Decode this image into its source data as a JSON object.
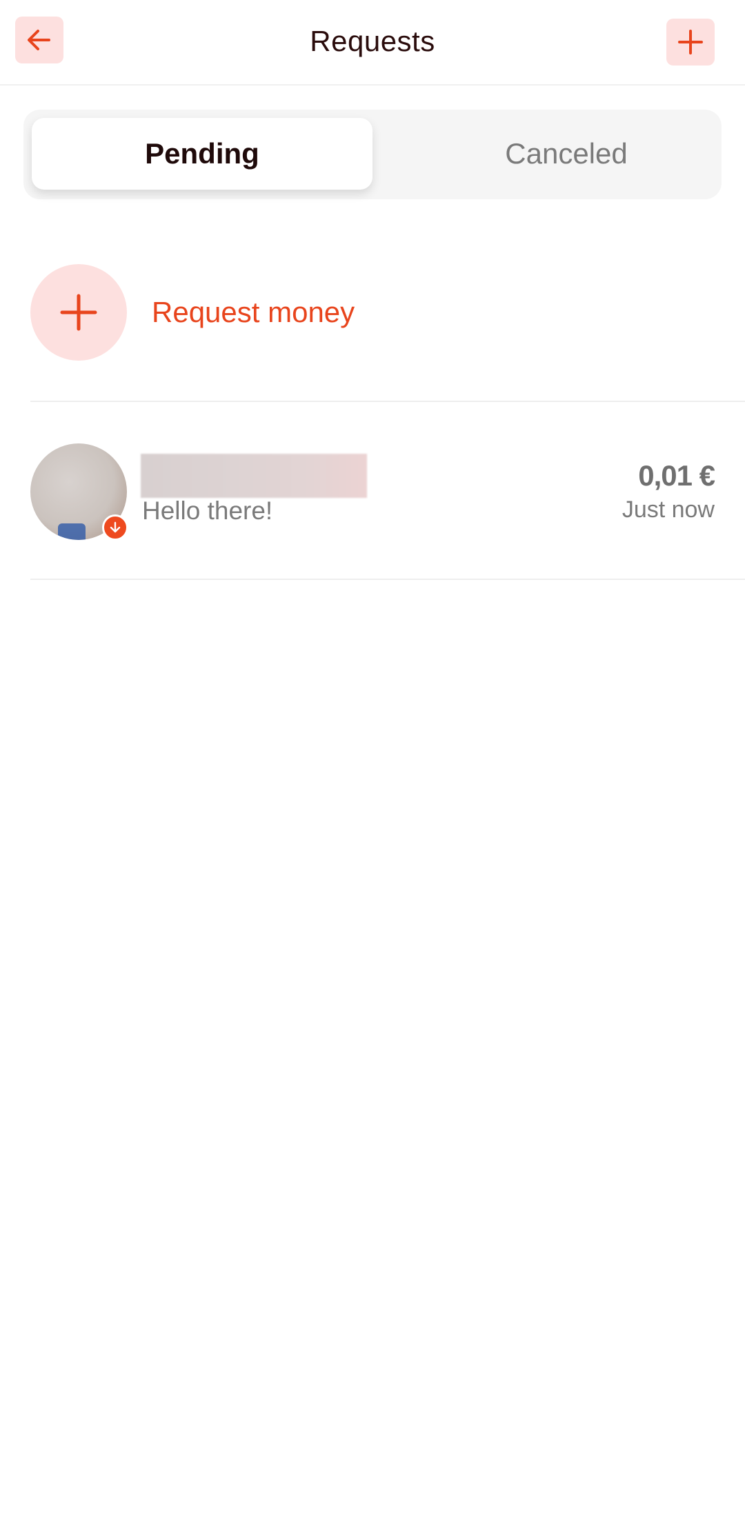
{
  "header": {
    "title": "Requests",
    "back_icon": "arrow-left-icon",
    "add_icon": "plus-icon"
  },
  "tabs": [
    {
      "label": "Pending",
      "active": true
    },
    {
      "label": "Canceled",
      "active": false
    }
  ],
  "request_action": {
    "label": "Request money",
    "icon": "plus-icon"
  },
  "transactions": [
    {
      "message": "Hello there!",
      "amount": "0,01 €",
      "time": "Just now",
      "direction_icon": "arrow-down-icon"
    }
  ],
  "colors": {
    "accent": "#e8441c",
    "accent_light": "#fde0df",
    "text_dark": "#1f0a0a",
    "text_muted": "#7a7a7a"
  }
}
